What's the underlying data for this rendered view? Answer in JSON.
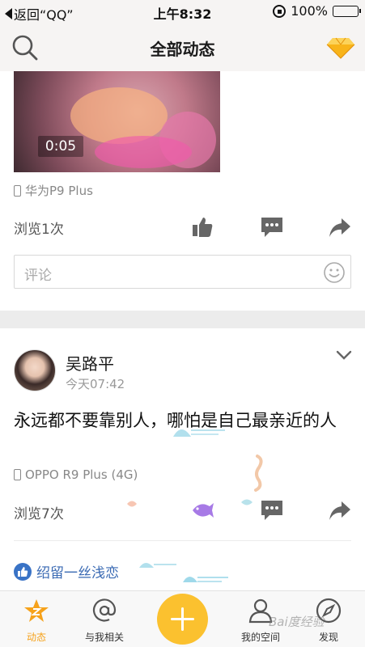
{
  "status_bar": {
    "back_label": "返回“QQ”",
    "time": "上午8:32",
    "battery": "100%"
  },
  "nav": {
    "title": "全部动态",
    "left_icon": "search-icon",
    "right_icon": "diamond-vip-icon"
  },
  "post1": {
    "video_duration": "0:05",
    "device": "华为P9 Plus",
    "views": "浏览1次",
    "comment_placeholder": "评论"
  },
  "post2": {
    "author": "吴路平",
    "time": "今天07:42",
    "text": "永远都不要靠别人，哪怕是自己最亲近的人",
    "device": "OPPO R9 Plus (4G)",
    "views": "浏览7次",
    "liked_by": "绍留一丝浅恋"
  },
  "tabbar": {
    "tabs": [
      {
        "label": "动态",
        "icon": "qzone-star-icon",
        "active": true
      },
      {
        "label": "与我相关",
        "icon": "at-icon",
        "active": false
      },
      {
        "label": "我的空间",
        "icon": "person-icon",
        "active": false
      },
      {
        "label": "发现",
        "icon": "compass-icon",
        "active": false
      }
    ],
    "add_icon": "plus-icon"
  },
  "watermark": "Bai度经验",
  "colors": {
    "accent": "#f6a21b",
    "plus_button": "#fbc12f",
    "link_blue": "#3a6ab3",
    "icon_gray": "#666666"
  }
}
